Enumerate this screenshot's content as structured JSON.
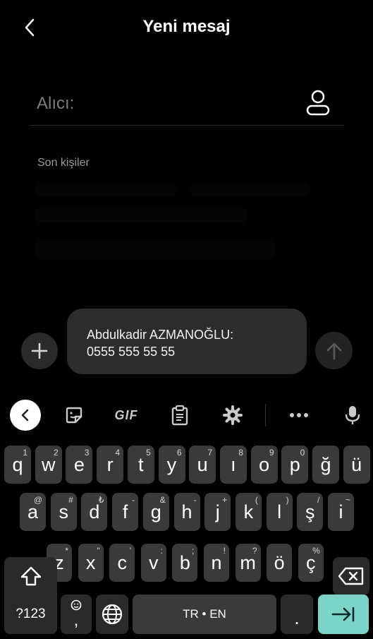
{
  "header": {
    "title": "Yeni mesaj"
  },
  "recipient": {
    "placeholder": "Alıcı:"
  },
  "recent": {
    "label": "Son kişiler"
  },
  "clipboard": {
    "line1": "Abdulkadir AZMANOĞLU:",
    "line2": "0555 555 55 55"
  },
  "toolbar": {
    "gif": "GIF"
  },
  "colors": {
    "background": "#000000",
    "key": "#3a3a3a",
    "enter_key": "#7cd4c9"
  },
  "keyboard": {
    "row1": [
      {
        "k": "q",
        "h": "1"
      },
      {
        "k": "w",
        "h": "2"
      },
      {
        "k": "e",
        "h": "3"
      },
      {
        "k": "r",
        "h": "4"
      },
      {
        "k": "t",
        "h": "5"
      },
      {
        "k": "y",
        "h": "6"
      },
      {
        "k": "u",
        "h": "7"
      },
      {
        "k": "ı",
        "h": "8"
      },
      {
        "k": "o",
        "h": "9"
      },
      {
        "k": "p",
        "h": "0"
      },
      {
        "k": "ğ",
        "h": ""
      },
      {
        "k": "ü",
        "h": ""
      }
    ],
    "row2": [
      {
        "k": "a",
        "h": "@"
      },
      {
        "k": "s",
        "h": "#"
      },
      {
        "k": "d",
        "h": "₺"
      },
      {
        "k": "f",
        "h": "-"
      },
      {
        "k": "g",
        "h": "&"
      },
      {
        "k": "h",
        "h": "-"
      },
      {
        "k": "j",
        "h": "+"
      },
      {
        "k": "k",
        "h": "("
      },
      {
        "k": "l",
        "h": ")"
      },
      {
        "k": "ş",
        "h": "/"
      },
      {
        "k": "i",
        "h": "~"
      }
    ],
    "row3": [
      {
        "k": "z",
        "h": "*"
      },
      {
        "k": "x",
        "h": "\""
      },
      {
        "k": "c",
        "h": "'"
      },
      {
        "k": "v",
        "h": ":"
      },
      {
        "k": "b",
        "h": ";"
      },
      {
        "k": "n",
        "h": "!"
      },
      {
        "k": "m",
        "h": "?"
      },
      {
        "k": "ö",
        "h": ""
      },
      {
        "k": "ç",
        "h": "%"
      }
    ],
    "symbols_label": "?123",
    "comma": ",",
    "space_label": "TR • EN",
    "period": "."
  }
}
